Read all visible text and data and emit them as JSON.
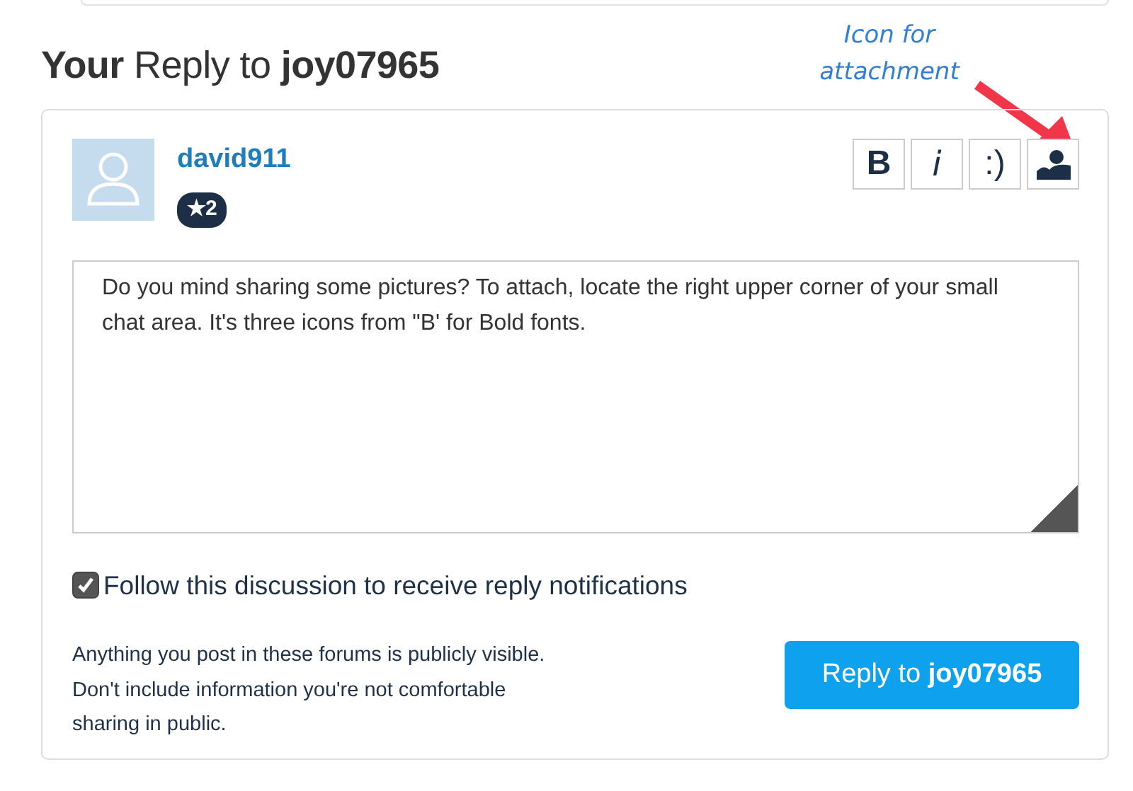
{
  "heading": "**Your** Reply to **joy07965**",
  "annotation": {
    "lines": [
      "Icon for",
      "attachment"
    ]
  },
  "author": {
    "username": "david911",
    "badge": "★2"
  },
  "toolbar": [
    {
      "kind": "text",
      "label": "B"
    },
    {
      "kind": "text",
      "label": "i"
    },
    {
      "kind": "text",
      "label": ":)"
    },
    {
      "kind": "image"
    }
  ],
  "reply": {
    "value": "Do you mind sharing some pictures? To attach, locate the right upper corner of your small chat area. It's three icons from \"B' for Bold fonts."
  },
  "follow": {
    "label": "Follow this discussion to receive reply notifications",
    "checked": true
  },
  "disclaimer": "Anything you post in these forums is publicly visible. Don't include information you're not comfortable sharing in public.",
  "submit": "Reply to **joy07965**"
}
